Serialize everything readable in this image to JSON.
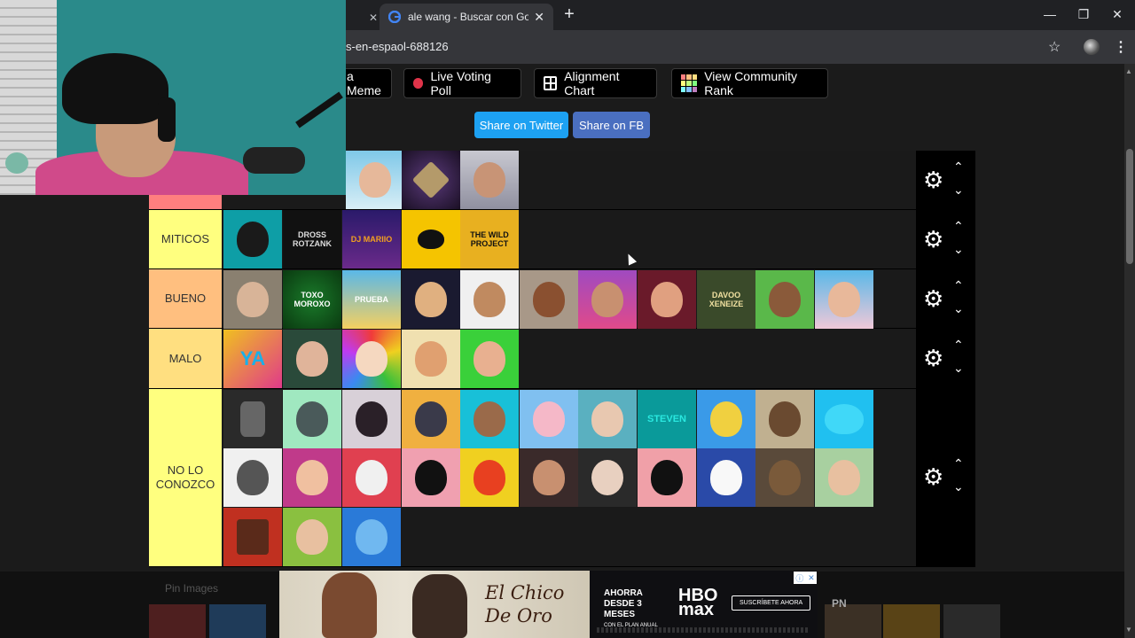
{
  "browser": {
    "active_tab_title": "ale wang - Buscar con Google",
    "url_fragment": "s-en-espaol-688126",
    "controls": {
      "minimize": "—",
      "restore": "❐",
      "close": "✕",
      "new_tab": "+",
      "tab_close": "✕",
      "star": "☆",
      "menu": "⋮"
    }
  },
  "toolbar": {
    "meme_label": "a Meme",
    "live_poll_label": "Live Voting Poll",
    "alignment_label": "Alignment Chart",
    "community_label": "View Community Rank",
    "twitter_label": "Share on Twitter",
    "fb_label": "Share on FB"
  },
  "colors": {
    "tier_yellow": "#ffff7f",
    "tier_orange": "#ffbf7f",
    "tier_top": "#ff7f7f",
    "twitter": "#1da1f2",
    "facebook": "#4267b2"
  },
  "tiers": [
    {
      "label": "",
      "color": "#ff7f7f"
    },
    {
      "label": "MITICOS",
      "color": "#ffff7f"
    },
    {
      "label": "BUENO",
      "color": "#ffbf7f"
    },
    {
      "label": "MALO",
      "color": "#ffdf80"
    },
    {
      "label": "NO LO CONOZCO",
      "color": "#ffff7f"
    }
  ],
  "tile_texts": {
    "dross": "DROSS ROTZANK",
    "dj": "DJ MARIIO",
    "wild": "THE WILD PROJECT",
    "toxo": "TOXO MOROXO",
    "prueba": "PRUEBA",
    "davoo": "DAVOO XENEIZE",
    "ya": "YA",
    "steven": "STEVEN"
  },
  "ad": {
    "brand": "El Chico De Oro",
    "offer": "AHORRA DESDE 3 MESES",
    "offer_sub": "CON EL PLAN ANUAL",
    "hbo": "HBO max",
    "cta": "SUSCRÍBETE AHORA"
  },
  "bottom": {
    "pin_label": "Pin Images",
    "pn": "PN"
  },
  "icons": {
    "gear": "⚙",
    "up": "⌃",
    "down": "⌄"
  }
}
